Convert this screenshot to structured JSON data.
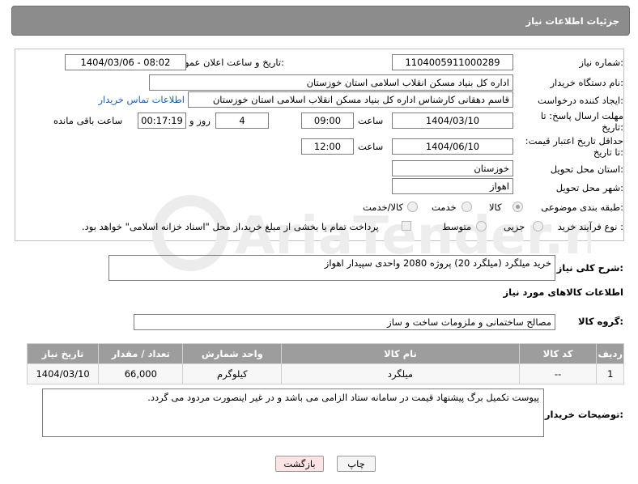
{
  "header": {
    "title": "جزئیات اطلاعات نیاز"
  },
  "form": {
    "need_number_label": "شماره نیاز:",
    "need_number": "1104005911000289",
    "announce_label": "تاریخ و ساعت اعلان عمومی:",
    "announce_value": "1404/03/06 - 08:02",
    "buyer_org_label": "نام دستگاه خریدار:",
    "buyer_org": "اداره کل بنیاد مسکن انقلاب اسلامی استان خوزستان",
    "creator_label": "ایجاد کننده درخواست:",
    "creator": "قاسم دهقانی کارشناس اداره کل بنیاد مسکن انقلاب اسلامی استان خوزستان",
    "contact_link": "اطلاعات تماس خریدار",
    "reply_deadline_label": "مهلت ارسال پاسخ: تا تاریخ:",
    "reply_date": "1404/03/10",
    "time_label": "ساعت",
    "reply_time": "09:00",
    "days_value": "4",
    "days_label": "روز و",
    "remaining_time": "00:17:19",
    "remaining_label": "ساعت باقی مانده",
    "price_validity_label": "حداقل تاریخ اعتبار قیمت: تا تاریخ:",
    "validity_date": "1404/06/10",
    "validity_time_label": "ساعت",
    "validity_time": "12:00",
    "province_label": "استان محل تحویل:",
    "province": "خوزستان",
    "city_label": "شهر محل تحویل:",
    "city": "اهواز",
    "category_label": "طبقه بندی موضوعی:",
    "category_options": [
      "کالا",
      "خدمت",
      "کالا/خدمت"
    ],
    "category_selected": "کالا",
    "process_label": "نوع فرآیند خرید :",
    "process_options": [
      "جزیی",
      "متوسط"
    ],
    "payment_note": "پرداخت تمام یا بخشی از مبلغ خرید،از محل \"اسناد خزانه اسلامی\" خواهد بود."
  },
  "description": {
    "label": "شرح کلی نیاز:",
    "text": "خرید میلگرد (میلگرد 20) پروژه  2080 واحدی سپیدار اهواز"
  },
  "goods": {
    "section_title": "اطلاعات کالاهای مورد نیاز",
    "group_label": "گروه کالا:",
    "group_value": "مصالح ساختمانی و ملزومات ساخت و ساز",
    "columns": [
      "ردیف",
      "کد کالا",
      "نام کالا",
      "واحد شمارش",
      "تعداد / مقدار",
      "تاریخ نیاز"
    ],
    "rows": [
      {
        "idx": "1",
        "code": "--",
        "name": "میلگرد",
        "unit": "کیلوگرم",
        "qty": "66,000",
        "date": "1404/03/10"
      }
    ]
  },
  "buyer_notes": {
    "label": "توضیحات خریدار:",
    "text": "پیوست تکمیل برگ پیشنهاد قیمت در سامانه ستاد الزامی می باشد و در غیر اینصورت مردود می گردد."
  },
  "buttons": {
    "print": "چاپ",
    "back": "بازگشت"
  },
  "colors": {
    "header_bg": "#8c8c8c",
    "link": "#1a5fb4",
    "table_header": "#9d9d9d",
    "back_button_bg": "#fde4e4"
  }
}
